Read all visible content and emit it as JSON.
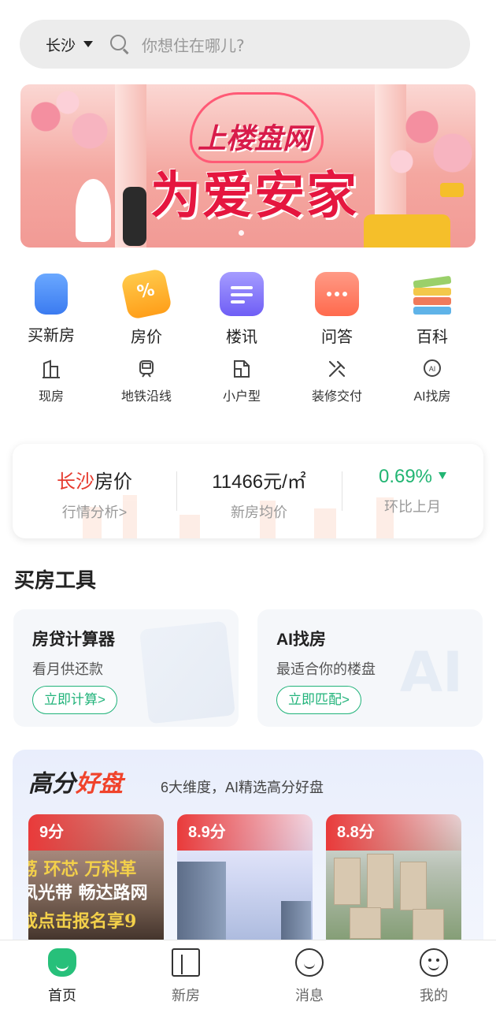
{
  "search": {
    "city": "长沙",
    "placeholder": "你想住在哪儿?"
  },
  "banner": {
    "brand": "上楼盘网",
    "slogan": "为爱安家"
  },
  "quick_nav_primary": [
    {
      "label": "买新房",
      "icon": "building-icon"
    },
    {
      "label": "房价",
      "icon": "price-tag-icon"
    },
    {
      "label": "楼讯",
      "icon": "news-icon"
    },
    {
      "label": "问答",
      "icon": "chat-bubble-icon"
    },
    {
      "label": "百科",
      "icon": "book-stack-icon"
    }
  ],
  "quick_nav_secondary": [
    {
      "label": "现房",
      "icon": "ready-house-icon"
    },
    {
      "label": "地铁沿线",
      "icon": "subway-icon"
    },
    {
      "label": "小户型",
      "icon": "floorplan-icon"
    },
    {
      "label": "装修交付",
      "icon": "tools-icon"
    },
    {
      "label": "AI找房",
      "icon": "ai-search-icon"
    }
  ],
  "price_card": {
    "city": "长沙",
    "title_suffix": "房价",
    "analysis_link": "行情分析>",
    "avg_price": "11466元/㎡",
    "avg_price_label": "新房均价",
    "change": "0.69%",
    "change_direction": "down",
    "change_label": "环比上月",
    "accent_color": "#e63a2e",
    "change_color": "#22b573"
  },
  "tools": {
    "section_title": "买房工具",
    "cards": [
      {
        "title": "房贷计算器",
        "subtitle": "看月供还款",
        "button": "立即计算>"
      },
      {
        "title": "AI找房",
        "subtitle": "最适合你的楼盘",
        "button": "立即匹配>"
      }
    ]
  },
  "high_score": {
    "title_a": "高分",
    "title_b": "好盘",
    "subtitle": "6大维度，AI精选高分好盘",
    "cards": [
      {
        "score": "9分",
        "ad_lines": [
          "荔 环芯 万科革",
          "凤光带 畅达路网",
          "或点击报名享9"
        ]
      },
      {
        "score": "8.9分"
      },
      {
        "score": "8.8分"
      }
    ]
  },
  "tabbar": {
    "tabs": [
      {
        "label": "首页",
        "icon": "home-icon",
        "active": true
      },
      {
        "label": "新房",
        "icon": "building-outline-icon",
        "active": false
      },
      {
        "label": "消息",
        "icon": "message-icon",
        "active": false
      },
      {
        "label": "我的",
        "icon": "profile-icon",
        "active": false
      }
    ],
    "active_color": "#27c07a"
  }
}
